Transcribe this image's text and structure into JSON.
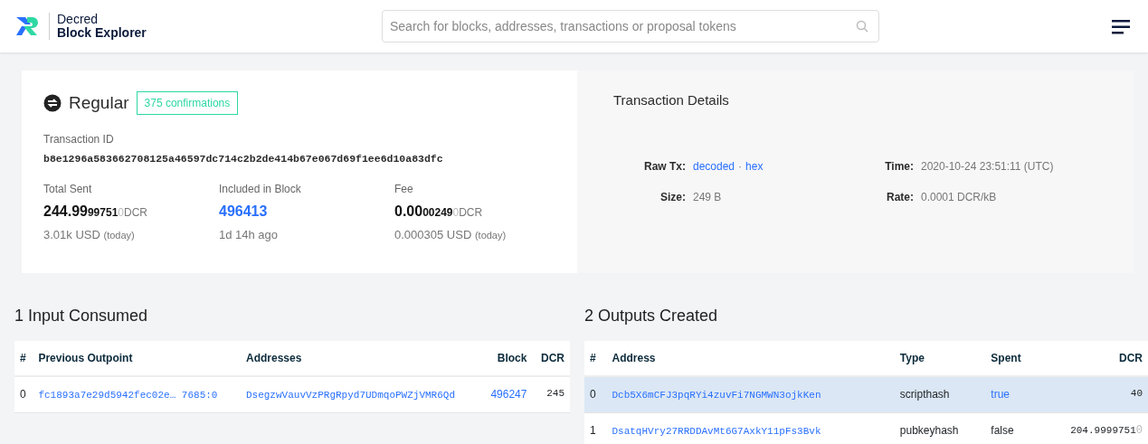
{
  "header": {
    "logo_line1": "Decred",
    "logo_line2": "Block Explorer",
    "search": {
      "placeholder": "Search for blocks, addresses, transactions or proposal tokens"
    }
  },
  "summary": {
    "type": "Regular",
    "confirmations": "375 confirmations",
    "txid_label": "Transaction ID",
    "txid": "b8e1296a583662708125a46597dc714c2b2de414b67e067d69f1ee6d10a83dfc",
    "total_sent": {
      "label": "Total Sent",
      "main": "244.99",
      "decimals": "99751",
      "zeros": "0",
      "unit": "DCR",
      "usd": "3.01k USD",
      "usd_note": "(today)"
    },
    "block": {
      "label": "Included in Block",
      "value": "496413",
      "age": "1d 14h ago"
    },
    "fee": {
      "label": "Fee",
      "main": "0.00",
      "decimals": "00249",
      "zeros": "0",
      "unit": "DCR",
      "usd": "0.000305 USD",
      "usd_note": "(today)"
    }
  },
  "details": {
    "title": "Transaction Details",
    "raw_label": "Raw Tx:",
    "raw_links": [
      "decoded",
      "hex"
    ],
    "raw_separator": "·",
    "size_label": "Size:",
    "size": "249 B",
    "time_label": "Time:",
    "time": "2020-10-24 23:51:11 (UTC)",
    "rate_label": "Rate:",
    "rate": "0.0001 DCR/kB"
  },
  "inputs": {
    "title": "1 Input Consumed",
    "columns": [
      "#",
      "Previous Outpoint",
      "Addresses",
      "Block",
      "DCR"
    ],
    "rows": [
      {
        "index": "0",
        "outpoint": "fc1893a7e29d5942fec02e… 7685:0",
        "address": "DsegzwVauvVzPRgRpyd7UDmqoPWZjVMR6Qd",
        "block": "496247",
        "amount": "245",
        "amount_zeros": ""
      }
    ]
  },
  "outputs": {
    "title": "2 Outputs Created",
    "columns": [
      "#",
      "Address",
      "Type",
      "Spent",
      "DCR"
    ],
    "rows": [
      {
        "index": "0",
        "address": "Dcb5X6mCFJ3pqRYi4zuvFi7NGMWN3ojkKen",
        "type": "scripthash",
        "spent": "true",
        "spent_linked": true,
        "amount": "40",
        "amount_zeros": "",
        "selected": true
      },
      {
        "index": "1",
        "address": "DsatqHVry27RRDDAvMt6G7AxkY11pFs3Bvk",
        "type": "pubkeyhash",
        "spent": "false",
        "spent_linked": false,
        "amount": "204.9999751",
        "amount_zeros": "0",
        "selected": false
      }
    ]
  }
}
